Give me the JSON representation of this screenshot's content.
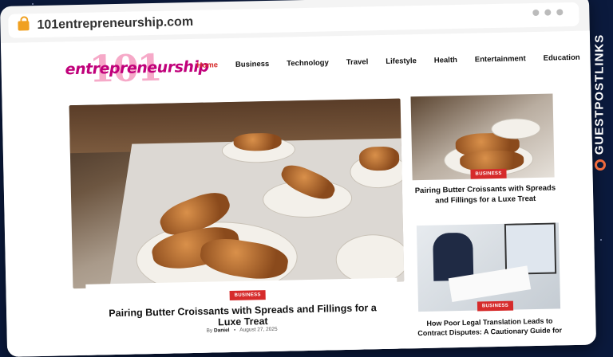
{
  "browser": {
    "url": "101entrepreneurship.com"
  },
  "logo": {
    "number": "101",
    "word": "entrepreneurship"
  },
  "nav": {
    "items": [
      "Home",
      "Business",
      "Technology",
      "Travel",
      "Lifestyle",
      "Health",
      "Entertainment",
      "Education"
    ],
    "active": "Home"
  },
  "hero": {
    "badge": "BUSINESS",
    "title": "Pairing Butter Croissants with Spreads and Fillings for a Luxe Treat",
    "by_label": "By",
    "author": "Daniel",
    "separator": "•",
    "date": "August 27, 2025"
  },
  "side_posts": [
    {
      "badge": "BUSINESS",
      "title": "Pairing Butter Croissants with Spreads and Fillings for a Luxe Treat"
    },
    {
      "badge": "BUSINESS",
      "title": "How Poor Legal Translation Leads to Contract Disputes: A Cautionary Guide for"
    }
  ],
  "watermark": {
    "text": "GUESTPOSTLINKS"
  },
  "colors": {
    "accent": "#d62b2b",
    "background": "#0b1a3d",
    "logo_pink": "#c0007a",
    "watermark_icon": "#ef6a3d"
  }
}
